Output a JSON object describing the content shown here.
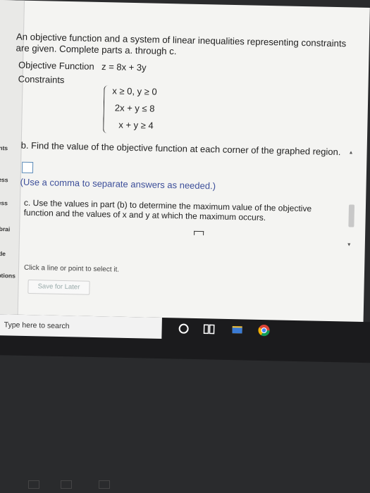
{
  "sidebar": {
    "labels": [
      "ents",
      "cess",
      "cess",
      "Librai",
      "uide",
      "Options",
      "ns"
    ]
  },
  "problem": {
    "intro": "An objective function and a system of linear inequalities representing constraints are given. Complete parts a. through c.",
    "objective_label": "Objective Function",
    "objective_expr": "z = 8x + 3y",
    "constraints_label": "Constraints",
    "constraints": [
      "x ≥ 0, y ≥ 0",
      "2x + y ≤ 8",
      "x + y ≥ 4"
    ]
  },
  "part_b": {
    "text": "b. Find the value of the objective function at each corner of the graphed region.",
    "hint": "(Use a comma to separate answers as needed.)",
    "answer_value": ""
  },
  "part_c": {
    "text": "c. Use the values in part (b) to determine the maximum value of the objective function and the values of x and y at which the maximum occurs."
  },
  "instruction": "Click a line or point to select it.",
  "save_button": "Save for Later",
  "taskbar": {
    "search_placeholder": "Type here to search"
  },
  "colors": {
    "page_bg": "#f4f4f2",
    "hint_text": "#3d4f9a",
    "taskbar": "#1b1b1d"
  },
  "icons": [
    "cortana-icon",
    "task-view-icon",
    "file-explorer-icon",
    "chrome-icon"
  ]
}
